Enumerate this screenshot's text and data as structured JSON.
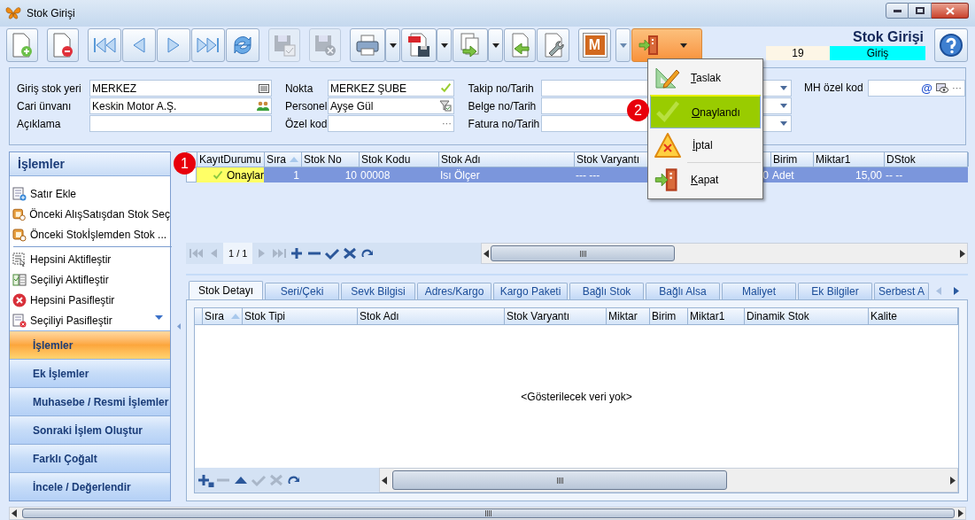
{
  "window": {
    "title": "Stok Girişi"
  },
  "toolbar": [
    {
      "kind": "new",
      "disabled": false
    },
    {
      "kind": "delete",
      "disabled": false
    },
    {
      "kind": "first",
      "disabled": false
    },
    {
      "kind": "prev",
      "disabled": false
    },
    {
      "kind": "next",
      "disabled": false
    },
    {
      "kind": "last",
      "disabled": false
    },
    {
      "kind": "refresh",
      "disabled": false
    },
    {
      "kind": "save",
      "disabled": true
    },
    {
      "kind": "save-cancel",
      "disabled": true
    },
    {
      "kind": "print",
      "disabled": false
    },
    {
      "kind": "pdf",
      "disabled": false
    },
    {
      "kind": "export",
      "disabled": false
    },
    {
      "kind": "import",
      "disabled": false
    },
    {
      "kind": "tools",
      "disabled": false
    },
    {
      "kind": "m",
      "disabled": false,
      "letter": "M"
    },
    {
      "kind": "exit",
      "disabled": false
    }
  ],
  "header": {
    "title": "Stok Girişi",
    "number": "19",
    "type": "Giriş"
  },
  "form": {
    "left": [
      {
        "label": "Giriş stok yeri",
        "value": "MERKEZ",
        "kind": "barcode"
      },
      {
        "label": "Cari ünvanı",
        "value": "Keskin Motor A.Ş.",
        "kind": "people"
      },
      {
        "label": "Açıklama"
      }
    ],
    "middle": [
      {
        "label": "Nokta",
        "value": "MERKEZ ŞUBE",
        "kind": "check"
      },
      {
        "label": "Personel",
        "value": "Ayşe Gül",
        "kind": "filter"
      },
      {
        "label": "Özel kod",
        "ellipsis": "···"
      }
    ],
    "right": [
      {
        "label": "Takip no/Tarih"
      },
      {
        "label": "Belge no/Tarih"
      },
      {
        "label": "Fatura no/Tarih"
      }
    ],
    "mh": {
      "label": "MH özel kod",
      "at": "@",
      "ellipsis": "···"
    }
  },
  "side": {
    "title": "İşlemler",
    "items": [
      {
        "label": "Satır Ekle",
        "kind": "add-row"
      },
      {
        "label": "Önceki AlışSatışdan Stok Seç",
        "kind": "box"
      },
      {
        "label": "Önceki Stokİşlemden Stok ...",
        "kind": "box"
      },
      {
        "label": "Hepsini Aktifleştir",
        "kind": "select-all"
      },
      {
        "label": "Seçiliyi Aktifleştir",
        "kind": "select"
      },
      {
        "label": "Hepsini Pasifleştir",
        "kind": "red-x"
      },
      {
        "label": "Seçiliyi Pasifleştir",
        "kind": "doc-x"
      }
    ],
    "sections": [
      {
        "label": "İşlemler",
        "selected": true
      },
      {
        "label": "Ek İşlemler",
        "selected": false
      },
      {
        "label": "Muhasebe / Resmi İşlemler",
        "selected": false
      },
      {
        "label": "Sonraki İşlem Oluştur",
        "selected": false
      },
      {
        "label": "Farklı Çoğalt",
        "selected": false
      },
      {
        "label": "İncele / Değerlendir",
        "selected": false
      }
    ]
  },
  "grid": {
    "columns": [
      {
        "label": "KayıtDurumu"
      },
      {
        "label": "Sıra",
        "sorted": true
      },
      {
        "label": "Stok No",
        "sorted": false
      },
      {
        "label": "Stok Kodu",
        "sorted": false
      },
      {
        "label": "Stok Adı",
        "sorted": false
      },
      {
        "label": "Stok Varyantı",
        "sorted": false
      },
      {},
      {
        "label": "Birim",
        "sorted": false
      },
      {
        "label": "Miktar1",
        "sorted": false
      },
      {
        "label": "DStok",
        "sorted": false
      }
    ],
    "rows": [
      {
        "selected": true,
        "cells": [
          "Onaylar",
          "1",
          "10",
          "00008",
          "Isı Ölçer",
          "--- ---",
          "0",
          "Adet",
          "15,00",
          "-- --"
        ]
      }
    ],
    "pager": "1 / 1"
  },
  "tabs": [
    {
      "label": "Stok Detayı",
      "selected": true
    },
    {
      "label": "Seri/Çeki",
      "selected": false
    },
    {
      "label": "Sevk Bilgisi",
      "selected": false
    },
    {
      "label": "Adres/Kargo",
      "selected": false
    },
    {
      "label": "Kargo Paketi",
      "selected": false
    },
    {
      "label": "Bağlı Stok",
      "selected": false
    },
    {
      "label": "Bağlı Alsa",
      "selected": false
    },
    {
      "label": "Maliyet",
      "selected": false
    },
    {
      "label": "Ek Bilgiler",
      "selected": false
    },
    {
      "label": "Serbest A",
      "selected": false
    }
  ],
  "detail_grid": {
    "columns": [
      {
        "label": "Sıra",
        "sorted": true
      },
      {
        "label": "Stok Tipi",
        "sorted": false
      },
      {
        "label": "Stok Adı",
        "sorted": false
      },
      {
        "label": "Stok Varyantı",
        "sorted": false
      },
      {
        "label": "Miktar",
        "sorted": false
      },
      {
        "label": "Birim",
        "sorted": false
      },
      {
        "label": "Miktar1",
        "sorted": false
      },
      {
        "label": "Dinamik Stok",
        "sorted": false
      },
      {
        "label": "Kalite",
        "sorted": false
      }
    ],
    "empty_text": "<Gösterilecek veri yok>"
  },
  "status_menu": {
    "items": [
      {
        "label": "Taslak",
        "kind": "draft",
        "selected": false
      },
      {
        "label": "Onaylandı",
        "kind": "approved",
        "selected": true
      },
      {
        "label": "İptal",
        "kind": "cancel",
        "selected": false
      },
      {
        "label": "Kapat",
        "kind": "close",
        "selected": false
      }
    ]
  },
  "callouts": [
    {
      "label": "1"
    },
    {
      "label": "2"
    }
  ]
}
